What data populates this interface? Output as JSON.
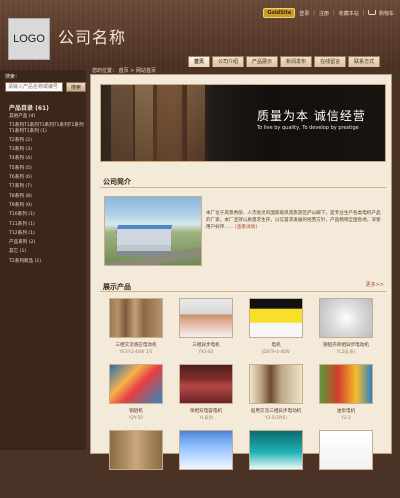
{
  "header": {
    "logo_text": "LOGO",
    "company_name": "公司名称",
    "top_links": [
      "GoldSite",
      "登录",
      "注册",
      "收藏本站"
    ],
    "cart_label": "购物车"
  },
  "nav": {
    "tabs": [
      {
        "label": "首页"
      },
      {
        "label": "公司介绍"
      },
      {
        "label": "产品展示"
      },
      {
        "label": "新闻发布"
      },
      {
        "label": "在线留言"
      },
      {
        "label": "联系方式"
      }
    ]
  },
  "breadcrumb": {
    "prefix": "您的位置：",
    "home": "首页",
    "current": "网站首页"
  },
  "search": {
    "label": "搜索：",
    "placeholder": "请输入产品名称或编号",
    "button": "搜索"
  },
  "categories": {
    "title": "产品目录 (61)",
    "items": [
      "其他产品 (4)",
      "T1系列T1系列T1系列T1系列T1系列T1系列T1系列 (1)",
      "T2系列 (2)",
      "T3系列 (3)",
      "T4系列 (4)",
      "T5系列 (5)",
      "T6系列 (6)",
      "T7系列 (7)",
      "T8系列 (8)",
      "T9系列 (9)",
      "T10系列 (1)",
      "T11系列 (1)",
      "T12系列 (1)",
      "产品系列 (2)",
      "其它 (1)",
      "T2系列新品 (1)"
    ]
  },
  "banner": {
    "headline": "质量为本 诚信经营",
    "tagline": "To live by quality, To develop by prestige"
  },
  "intro": {
    "title": "公司简介",
    "text": "本厂位于风景秀丽、人杰地灵的国家级风景旅游区庐山脚下，是专业生产各类电机产品的厂家，本厂坚持以质量求生存，以信誉求发展的经营方针，产品畅销全国各地，深受用户好评……",
    "more": "[查看详情]"
  },
  "products": {
    "title": "展示产品",
    "more": "更多>>",
    "items": [
      {
        "name": "三相交流感应电动机",
        "code": "YE3-Y2-40W 3/1"
      },
      {
        "name": "三相异步电机",
        "code": "YX3-B3"
      },
      {
        "name": "电机",
        "code": "JD079-4-40W"
      },
      {
        "name": "钢铝壳单相异步电动机",
        "code": "YL2(JL系)"
      },
      {
        "name": "钢铝机",
        "code": "Y2Y-5R"
      },
      {
        "name": "单相双电容电机",
        "code": "YL系列"
      },
      {
        "name": "船用交流三相异步电动机",
        "code": "Y3-5/3P(6)"
      },
      {
        "name": "油泵电机",
        "code": "Y2-2"
      },
      {
        "name": "",
        "code": ""
      },
      {
        "name": "",
        "code": ""
      },
      {
        "name": "",
        "code": ""
      },
      {
        "name": "",
        "code": ""
      }
    ]
  },
  "colors": {
    "header_bg": "#5a3b2c",
    "panel_bg": "#f4ead9",
    "accent": "#b0473a",
    "gold": "#c99c2a"
  }
}
